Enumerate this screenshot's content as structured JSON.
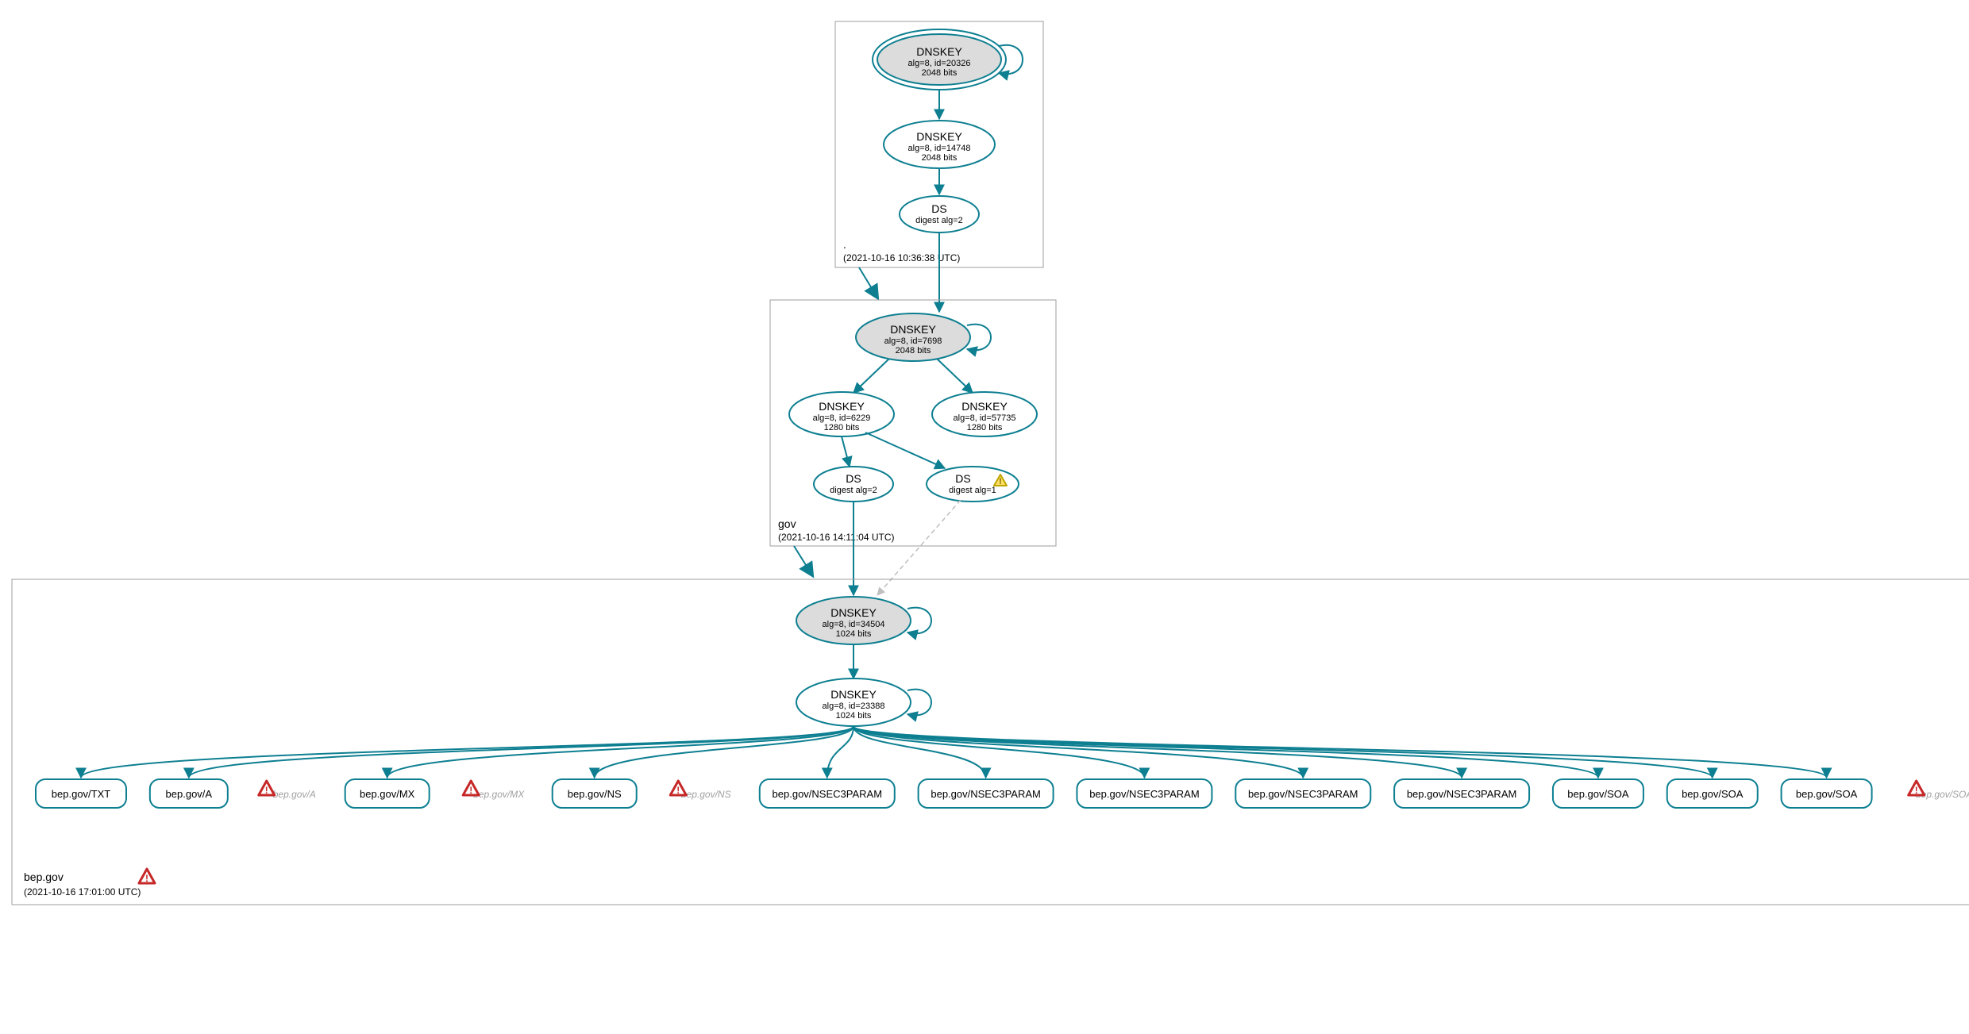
{
  "colors": {
    "accent": "#0d7f91",
    "boxstroke": "#9e9e9e",
    "gray": "#bfbfbf",
    "warn_red": "#c62828",
    "warn_yellow_fill": "#ffe066",
    "ksk_fill": "#dcdcdc"
  },
  "zones": {
    "root": {
      "label": ".",
      "timestamp": "(2021-10-16 10:36:38 UTC)",
      "nodes": {
        "ksk": {
          "title": "DNSKEY",
          "sub1": "alg=8, id=20326",
          "sub2": "2048 bits"
        },
        "zsk": {
          "title": "DNSKEY",
          "sub1": "alg=8, id=14748",
          "sub2": "2048 bits"
        },
        "ds": {
          "title": "DS",
          "sub1": "digest alg=2"
        }
      }
    },
    "gov": {
      "label": "gov",
      "timestamp": "(2021-10-16 14:11:04 UTC)",
      "nodes": {
        "ksk": {
          "title": "DNSKEY",
          "sub1": "alg=8, id=7698",
          "sub2": "2048 bits"
        },
        "zsk1": {
          "title": "DNSKEY",
          "sub1": "alg=8, id=6229",
          "sub2": "1280 bits"
        },
        "zsk2": {
          "title": "DNSKEY",
          "sub1": "alg=8, id=57735",
          "sub2": "1280 bits"
        },
        "ds1": {
          "title": "DS",
          "sub1": "digest alg=2"
        },
        "ds2": {
          "title": "DS",
          "sub1": "digest alg=1",
          "warn": true
        }
      }
    },
    "bep": {
      "label": "bep.gov",
      "timestamp": "(2021-10-16 17:01:00 UTC)",
      "warn": true,
      "nodes": {
        "ksk": {
          "title": "DNSKEY",
          "sub1": "alg=8, id=34504",
          "sub2": "1024 bits"
        },
        "zsk": {
          "title": "DNSKEY",
          "sub1": "alg=8, id=23388",
          "sub2": "1024 bits"
        }
      },
      "rrsets": [
        {
          "label": "bep.gov/TXT"
        },
        {
          "label": "bep.gov/A"
        },
        {
          "label": "bep.gov/A",
          "gray": true,
          "warn": true
        },
        {
          "label": "bep.gov/MX"
        },
        {
          "label": "bep.gov/MX",
          "gray": true,
          "warn": true
        },
        {
          "label": "bep.gov/NS"
        },
        {
          "label": "bep.gov/NS",
          "gray": true,
          "warn": true
        },
        {
          "label": "bep.gov/NSEC3PARAM"
        },
        {
          "label": "bep.gov/NSEC3PARAM"
        },
        {
          "label": "bep.gov/NSEC3PARAM"
        },
        {
          "label": "bep.gov/NSEC3PARAM"
        },
        {
          "label": "bep.gov/NSEC3PARAM"
        },
        {
          "label": "bep.gov/SOA"
        },
        {
          "label": "bep.gov/SOA"
        },
        {
          "label": "bep.gov/SOA"
        },
        {
          "label": "bep.gov/SOA",
          "gray": true,
          "warn": true
        }
      ]
    }
  }
}
